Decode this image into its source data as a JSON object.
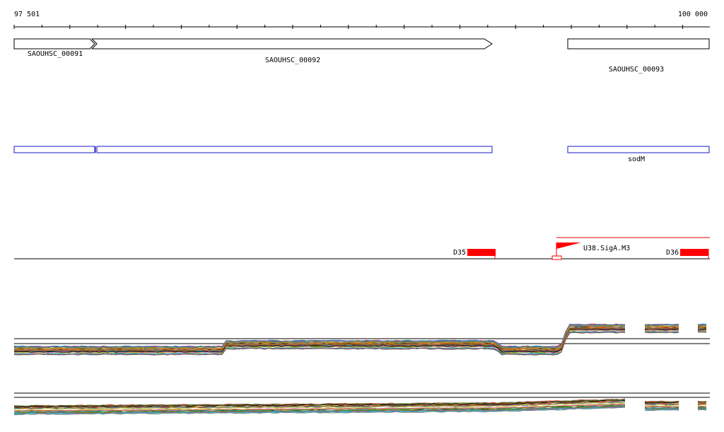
{
  "ruler": {
    "start_label": "97 501",
    "end_label": "100 000"
  },
  "genes": [
    {
      "name": "SAOUHSC_00091",
      "strand": "+"
    },
    {
      "name": "SAOUHSC_00092",
      "strand": "+"
    },
    {
      "name": "SAOUHSC_00093",
      "strand": "+"
    }
  ],
  "annotation_track": {
    "labels": [
      "sodM"
    ]
  },
  "features": [
    {
      "name": "D35"
    },
    {
      "name": "U38.SigA.M3"
    },
    {
      "name": "D36"
    }
  ],
  "colors": {
    "gene_outline": "#000000",
    "annotation_outline": "#1a1ac8",
    "feature_fill": "#ff0000",
    "axis": "#000000"
  }
}
